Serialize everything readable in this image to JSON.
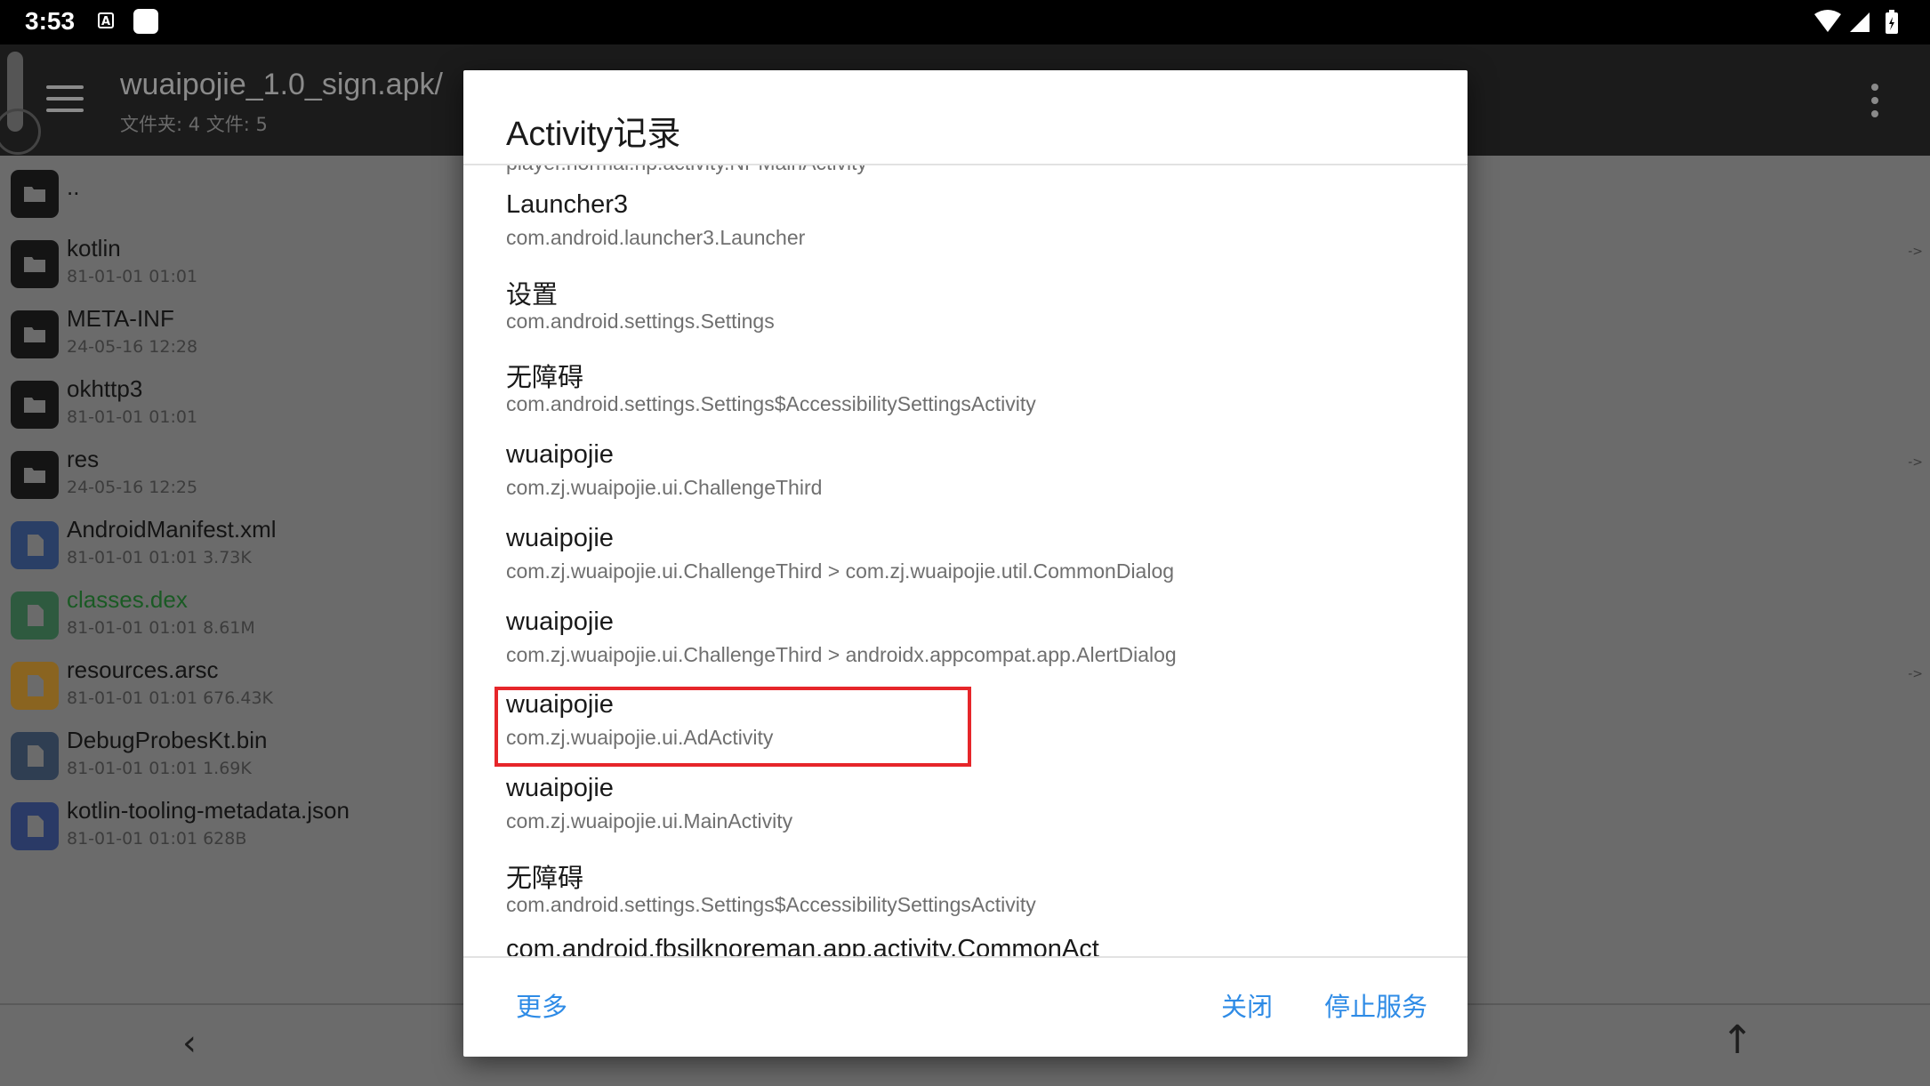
{
  "status_bar": {
    "time": "3:53",
    "badge": "A",
    "icons": [
      "wifi-icon",
      "signal-icon",
      "battery-icon"
    ]
  },
  "app_bar": {
    "title": "wuaipojie_1.0_sign.apk/",
    "subtitle": "文件夹: 4  文件: 5",
    "menu_icon": "menu-icon",
    "overflow_icon": "overflow-icon"
  },
  "files": [
    {
      "name": "..",
      "meta": "",
      "type": "folder"
    },
    {
      "name": "kotlin",
      "meta": "81-01-01 01:01",
      "type": "folder"
    },
    {
      "name": "META-INF",
      "meta": "24-05-16 12:28",
      "type": "folder"
    },
    {
      "name": "okhttp3",
      "meta": "81-01-01 01:01",
      "type": "folder"
    },
    {
      "name": "res",
      "meta": "24-05-16 12:25",
      "type": "folder"
    },
    {
      "name": "AndroidManifest.xml",
      "meta": "81-01-01 01:01  3.73K",
      "type": "xml"
    },
    {
      "name": "classes.dex",
      "meta": "81-01-01 01:01  8.61M",
      "type": "dex"
    },
    {
      "name": "resources.arsc",
      "meta": "81-01-01 01:01  676.43K",
      "type": "arsc"
    },
    {
      "name": "DebugProbesKt.bin",
      "meta": "81-01-01 01:01  1.69K",
      "type": "bin"
    },
    {
      "name": "kotlin-tooling-metadata.json",
      "meta": "81-01-01 01:01  628B",
      "type": "json"
    }
  ],
  "side_arrows": [
    "->",
    "->",
    "->"
  ],
  "bottom_bar": {
    "back": "‹",
    "up": "↑"
  },
  "dialog": {
    "title": "Activity记录",
    "partial_top": "player.normal.np.activity.NPMainActivity",
    "entries": [
      {
        "name": "Launcher3",
        "class": "com.android.launcher3.Launcher"
      },
      {
        "name": "设置",
        "class": "com.android.settings.Settings"
      },
      {
        "name": "无障碍",
        "class": "com.android.settings.Settings$AccessibilitySettingsActivity"
      },
      {
        "name": "wuaipojie",
        "class": "com.zj.wuaipojie.ui.ChallengeThird"
      },
      {
        "name": "wuaipojie",
        "class": "com.zj.wuaipojie.ui.ChallengeThird > com.zj.wuaipojie.util.CommonDialog"
      },
      {
        "name": "wuaipojie",
        "class": "com.zj.wuaipojie.ui.ChallengeThird > androidx.appcompat.app.AlertDialog"
      },
      {
        "name": "wuaipojie",
        "class": "com.zj.wuaipojie.ui.AdActivity"
      },
      {
        "name": "wuaipojie",
        "class": "com.zj.wuaipojie.ui.MainActivity"
      },
      {
        "name": "无障碍",
        "class": "com.android.settings.Settings$AccessibilitySettingsActivity"
      }
    ],
    "partial_bottom": "com.android.fbsilknoreman.app.activity.CommonAct",
    "buttons": {
      "more": "更多",
      "close": "关闭",
      "stop": "停止服务"
    },
    "accent_color": "#2e8be6",
    "highlight_color": "#e6262a"
  }
}
